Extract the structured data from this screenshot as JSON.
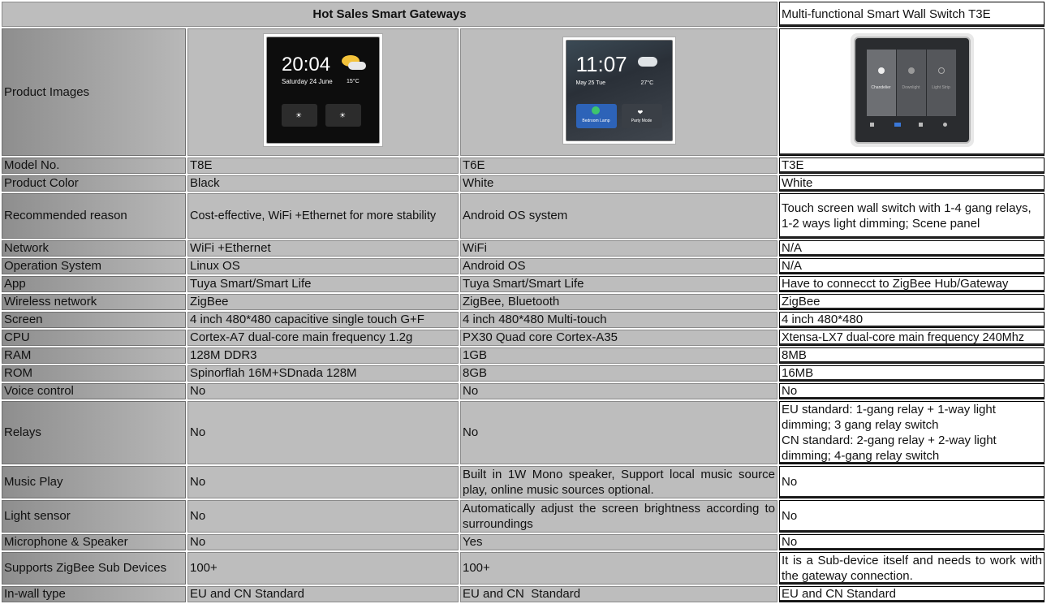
{
  "title": "Hot Sales Smart Gateways",
  "t3e_header": "Multi-functional Smart Wall Switch T3E",
  "rows": [
    {
      "label": "Product Images",
      "t8e": "",
      "t6e": "",
      "t3e": ""
    },
    {
      "label": "Model No.",
      "t8e": "T8E",
      "t6e": "T6E",
      "t3e": "T3E"
    },
    {
      "label": "Product Color",
      "t8e": "Black",
      "t6e": "White",
      "t3e": "White"
    },
    {
      "label": "Recommended reason",
      "t8e": "Cost-effective, WiFi +Ethernet for more stability",
      "t6e": "Android OS system",
      "t3e": "Touch screen wall switch with 1-4 gang relays, 1-2 ways light dimming; Scene panel"
    },
    {
      "label": "Network",
      "t8e": "WiFi +Ethernet",
      "t6e": "WiFi",
      "t3e": "N/A"
    },
    {
      "label": "Operation System",
      "t8e": "Linux OS",
      "t6e": "Android OS",
      "t3e": "N/A"
    },
    {
      "label": "App",
      "t8e": "Tuya Smart/Smart Life",
      "t6e": "Tuya Smart/Smart Life",
      "t3e": "Have to connecct to ZigBee Hub/Gateway"
    },
    {
      "label": "Wireless network",
      "t8e": "ZigBee",
      "t6e": "ZigBee, Bluetooth",
      "t3e": "ZigBee"
    },
    {
      "label": "Screen",
      "t8e": "4 inch 480*480 capacitive single touch G+F",
      "t6e": "4 inch 480*480 Multi-touch",
      "t3e": "4 inch 480*480"
    },
    {
      "label": "CPU",
      "t8e": "Cortex-A7 dual-core main frequency 1.2g",
      "t6e": "PX30 Quad core Cortex-A35",
      "t3e": "Xtensa-LX7 dual-core main frequency 240Mhz"
    },
    {
      "label": "RAM",
      "t8e": "128M DDR3",
      "t6e": "1GB",
      "t3e": "8MB"
    },
    {
      "label": "ROM",
      "t8e": "Spinorflah 16M+SDnada 128M",
      "t6e": "8GB",
      "t3e": "16MB"
    },
    {
      "label": "Voice control",
      "t8e": "No",
      "t6e": "No",
      "t3e": "No"
    },
    {
      "label": "Relays",
      "t8e": "No",
      "t6e": "No",
      "t3e": "EU standard: 1-gang relay + 1-way light dimming; 3 gang relay switch",
      "t3e_2": "CN standard: 2-gang relay + 2-way light dimming; 4-gang relay switch"
    },
    {
      "label": "Music Play",
      "t8e": "No",
      "t6e": "Built in 1W Mono speaker, Support local music source play, online music sources optional.",
      "t3e": "No"
    },
    {
      "label": "Light sensor",
      "t8e": "No",
      "t6e": "Automatically adjust the screen brightness according to surroundings",
      "t3e": "No"
    },
    {
      "label": "Microphone & Speaker",
      "t8e": "No",
      "t6e": "Yes",
      "t3e": "No"
    },
    {
      "label": "Supports ZigBee Sub Devices",
      "t8e": "100+",
      "t6e": "100+",
      "t3e": "It is a Sub-device itself and needs to work with the gateway connection."
    },
    {
      "label": "In-wall type",
      "t8e": "EU and CN Standard",
      "t6e": "EU and CN  Standard",
      "t3e": "EU and CN Standard"
    }
  ],
  "images": {
    "t8e": {
      "time": "20:04",
      "date": "Saturday 24 June",
      "temp": "15°C",
      "tile1": "",
      "tile2": ""
    },
    "t6e": {
      "time": "11:07",
      "date": "May 25 Tue",
      "temp": "27°C",
      "tile1": "Bedroom Lamp",
      "tile2": "Party Mode"
    },
    "t3e": {
      "b1": "Chandelier",
      "b2": "Downlight",
      "b3": "Light Strip"
    }
  }
}
